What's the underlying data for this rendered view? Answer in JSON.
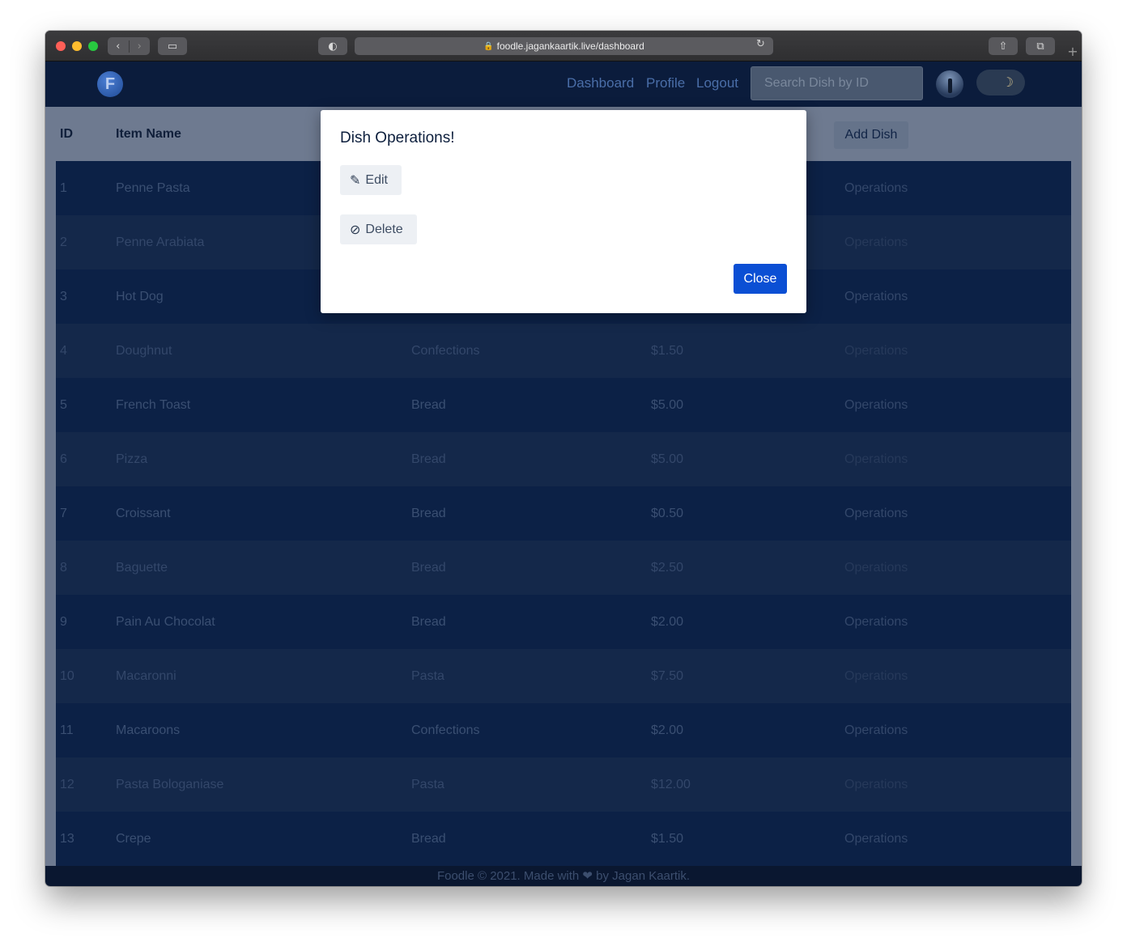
{
  "browser": {
    "url": "foodle.jagankaartik.live/dashboard",
    "back_icon": "‹",
    "forward_icon": "›",
    "sidebar_icon": "▭",
    "shield_icon": "◐",
    "reload_icon": "↻",
    "share_icon": "⇧",
    "tabs_icon": "⧉",
    "newtab_icon": "+"
  },
  "navbar": {
    "brand_letter": "F",
    "links": [
      "Dashboard",
      "Profile",
      "Logout"
    ],
    "search_placeholder": "Search Dish by ID",
    "toggle_icon": "☽"
  },
  "table": {
    "headers": {
      "id": "ID",
      "name": "Item Name"
    },
    "add_button": "Add Dish",
    "rows": [
      {
        "id": "1",
        "name": "Penne Pasta",
        "category": "",
        "price": "",
        "op": "Operations"
      },
      {
        "id": "2",
        "name": "Penne Arabiata",
        "category": "",
        "price": "",
        "op": "Operations"
      },
      {
        "id": "3",
        "name": "Hot Dog",
        "category": "",
        "price": "",
        "op": "Operations"
      },
      {
        "id": "4",
        "name": "Doughnut",
        "category": "Confections",
        "price": "$1.50",
        "op": "Operations"
      },
      {
        "id": "5",
        "name": "French Toast",
        "category": "Bread",
        "price": "$5.00",
        "op": "Operations"
      },
      {
        "id": "6",
        "name": "Pizza",
        "category": "Bread",
        "price": "$5.00",
        "op": "Operations"
      },
      {
        "id": "7",
        "name": "Croissant",
        "category": "Bread",
        "price": "$0.50",
        "op": "Operations"
      },
      {
        "id": "8",
        "name": "Baguette",
        "category": "Bread",
        "price": "$2.50",
        "op": "Operations"
      },
      {
        "id": "9",
        "name": "Pain Au Chocolat",
        "category": "Bread",
        "price": "$2.00",
        "op": "Operations"
      },
      {
        "id": "10",
        "name": "Macaronni",
        "category": "Pasta",
        "price": "$7.50",
        "op": "Operations"
      },
      {
        "id": "11",
        "name": "Macaroons",
        "category": "Confections",
        "price": "$2.00",
        "op": "Operations"
      },
      {
        "id": "12",
        "name": "Pasta Bologaniase",
        "category": "Pasta",
        "price": "$12.00",
        "op": "Operations"
      },
      {
        "id": "13",
        "name": "Crepe",
        "category": "Bread",
        "price": "$1.50",
        "op": "Operations"
      }
    ]
  },
  "footer": {
    "text": "Foodle © 2021. Made with ❤ by Jagan Kaartik."
  },
  "modal": {
    "title": "Dish Operations!",
    "edit_label": "Edit",
    "edit_icon": "✎",
    "delete_label": "Delete",
    "delete_icon": "⊘",
    "close_label": "Close"
  }
}
